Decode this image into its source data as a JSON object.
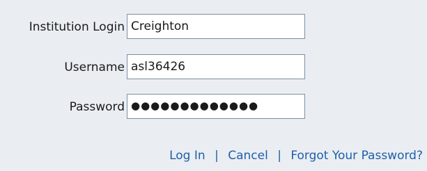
{
  "login_form": {
    "institution": {
      "label": "Institution Login",
      "value": "Creighton"
    },
    "username": {
      "label": "Username",
      "value": "asl36426"
    },
    "password": {
      "label": "Password",
      "masked_value": "●●●●●●●●●●●●●"
    }
  },
  "actions": {
    "login_label": "Log In",
    "separator": "|",
    "cancel_label": "Cancel",
    "forgot_label": "Forgot Your Password?"
  },
  "colors": {
    "background": "#eaeef3",
    "link": "#1f5fa8",
    "input_border": "#7a8ea6"
  }
}
